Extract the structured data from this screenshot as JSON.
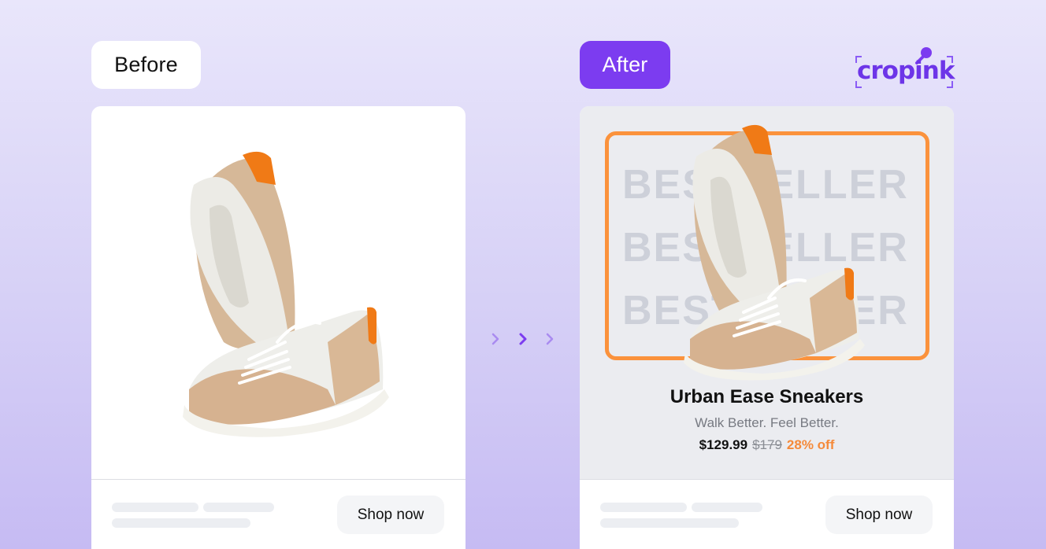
{
  "labels": {
    "before": "Before",
    "after": "After"
  },
  "brand": {
    "name": "cropink",
    "color": "#6d35e8"
  },
  "before_card": {
    "button_label": "Shop now"
  },
  "after_card": {
    "badge_word": "BESTSELLER",
    "product_title": "Urban Ease Sneakers",
    "tagline": "Walk Better. Feel Better.",
    "price": "$129.99",
    "old_price": "$179",
    "discount": "28% off",
    "button_label": "Shop now"
  },
  "icons": [
    "chevron-right-icon",
    "chevron-right-icon",
    "chevron-right-icon"
  ],
  "colors": {
    "accent": "#7c3cf0",
    "frame": "#fb923c",
    "discount": "#f58a3a"
  }
}
